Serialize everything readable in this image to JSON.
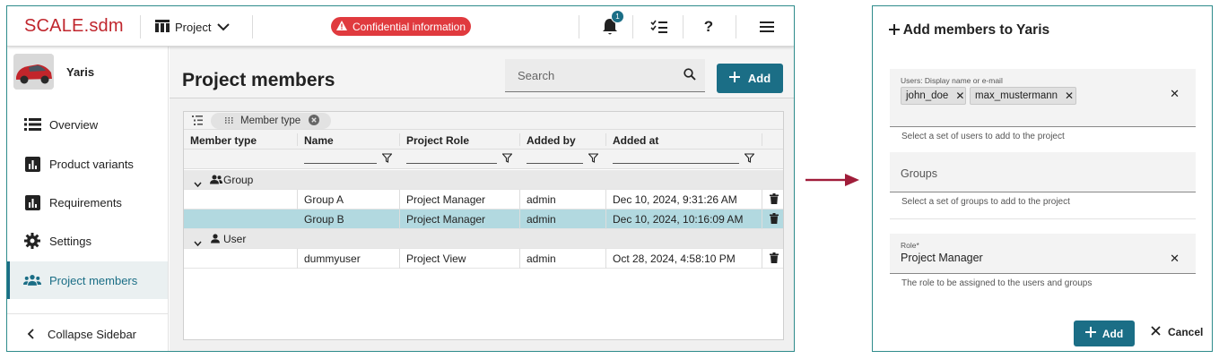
{
  "app": {
    "logo": "SCALE.sdm",
    "project_selector": "Project",
    "confidential_badge": "Confidential information",
    "notification_count": "1",
    "help_label": "?"
  },
  "sidebar": {
    "project_name": "Yaris",
    "items": [
      {
        "label": "Overview",
        "icon": "list-icon"
      },
      {
        "label": "Product variants",
        "icon": "bar-chart-icon"
      },
      {
        "label": "Requirements",
        "icon": "bar-chart-icon"
      },
      {
        "label": "Settings",
        "icon": "gear-icon"
      },
      {
        "label": "Project members",
        "icon": "people-icon",
        "active": true
      }
    ],
    "collapse_label": "Collapse Sidebar"
  },
  "main": {
    "title": "Project members",
    "search_placeholder": "Search",
    "add_label": "Add",
    "grouping_chip": "Member type",
    "columns": [
      "Member type",
      "Name",
      "Project Role",
      "Added by",
      "Added at"
    ],
    "groups": [
      {
        "label": "Group",
        "rows": [
          {
            "name": "Group A",
            "role": "Project Manager",
            "added_by": "admin",
            "added_at": "Dec 10, 2024, 9:31:26 AM",
            "selected": false
          },
          {
            "name": "Group B",
            "role": "Project Manager",
            "added_by": "admin",
            "added_at": "Dec 10, 2024, 10:16:09 AM",
            "selected": true
          }
        ]
      },
      {
        "label": "User",
        "rows": [
          {
            "name": "dummyuser",
            "role": "Project View",
            "added_by": "admin",
            "added_at": "Oct 28, 2024, 4:58:10 PM",
            "selected": false
          }
        ]
      }
    ]
  },
  "dialog": {
    "title": "Add members to Yaris",
    "users_label": "Users: Display name or e-mail",
    "users": [
      "john_doe",
      "max_mustermann"
    ],
    "users_help": "Select a set of users to add to the project",
    "groups_placeholder": "Groups",
    "groups_help": "Select a set of groups to add to the project",
    "role_label": "Role*",
    "role_value": "Project Manager",
    "role_help": "The role to be assigned to the users and groups",
    "add_label": "Add",
    "cancel_label": "Cancel"
  },
  "colors": {
    "brand_red": "#c0262d",
    "accent_teal": "#1b6e86",
    "selected_row": "#b2d9e0",
    "arrow": "#a01d3a"
  }
}
